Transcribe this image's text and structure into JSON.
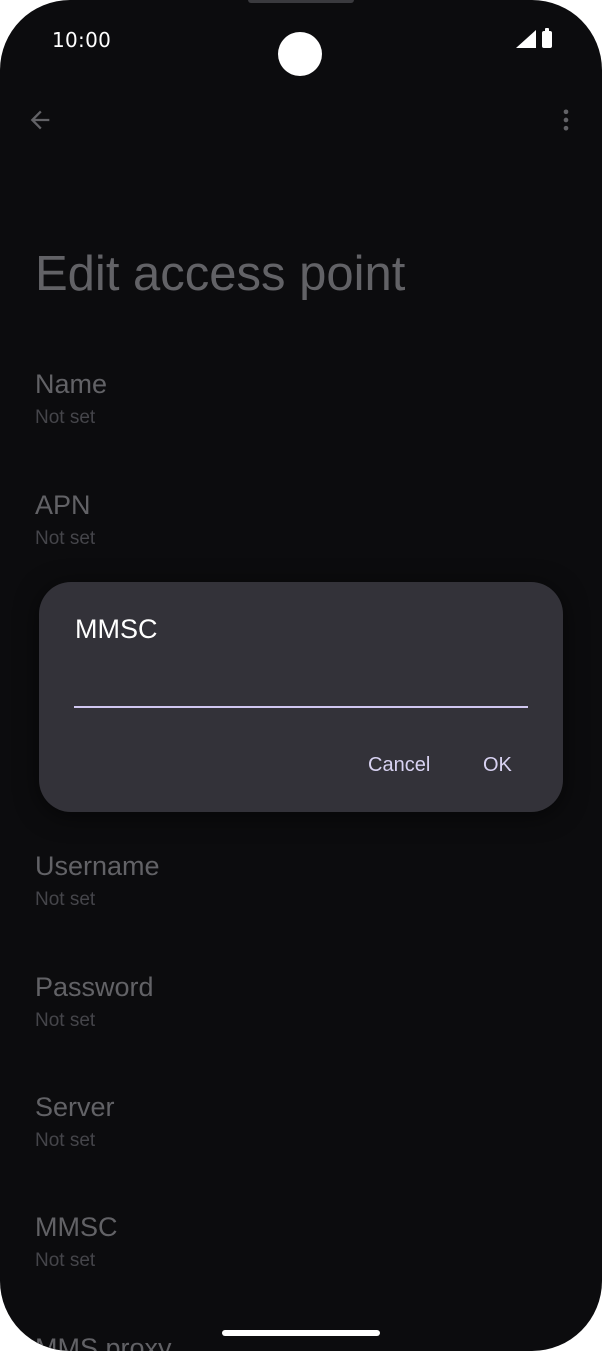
{
  "status_bar": {
    "time": "10:00"
  },
  "app_bar": {
    "back_icon": "arrow-left-icon",
    "more_icon": "more-vert-icon"
  },
  "page_title": "Edit access point",
  "settings": [
    {
      "title": "Name",
      "value": "Not set"
    },
    {
      "title": "APN",
      "value": "Not set"
    },
    {
      "title": "Username",
      "value": "Not set"
    },
    {
      "title": "Password",
      "value": "Not set"
    },
    {
      "title": "Server",
      "value": "Not set"
    },
    {
      "title": "MMSC",
      "value": "Not set"
    },
    {
      "title": "MMS proxy",
      "value": ""
    }
  ],
  "dialog": {
    "title": "MMSC",
    "input_value": "",
    "cancel_label": "Cancel",
    "ok_label": "OK"
  },
  "colors": {
    "background": "#0c0c0e",
    "dialog_background": "#333239",
    "accent": "#d0c7f0"
  }
}
